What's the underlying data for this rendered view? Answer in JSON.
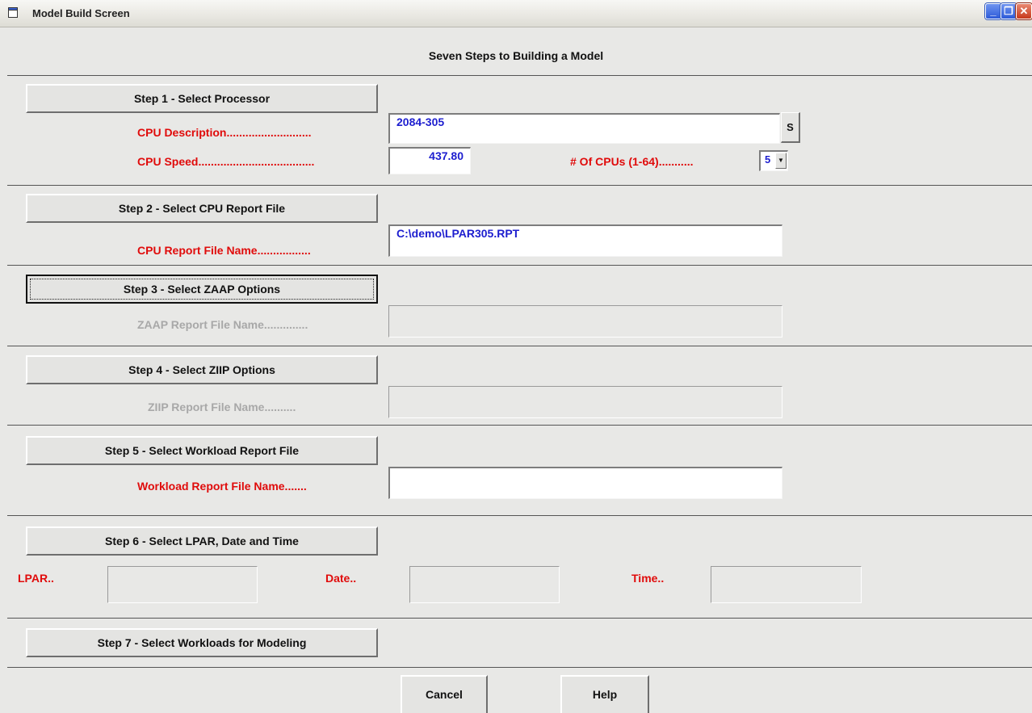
{
  "window": {
    "title": "Model Build Screen",
    "minimize": "_",
    "restore": "❐",
    "close": "✕",
    "icon": "window-app-icon"
  },
  "heading": "Seven Steps to Building a Model",
  "step1": {
    "button": "Step 1 - Select Processor",
    "cpu_description_label": "CPU Description...........................",
    "cpu_description_value": "2084-305",
    "s_button": "S",
    "cpu_speed_label": "CPU Speed.....................................",
    "cpu_speed_value": "437.80",
    "num_cpus_label": "# Of CPUs (1-64)...........",
    "num_cpus_value": "5",
    "dropdown_arrow": "▼"
  },
  "step2": {
    "button": "Step 2 - Select CPU Report File",
    "label": "CPU Report File Name.................",
    "value": "C:\\demo\\LPAR305.RPT"
  },
  "step3": {
    "button": "Step 3 - Select ZAAP Options",
    "label": "ZAAP Report File Name..............",
    "value": ""
  },
  "step4": {
    "button": "Step 4 - Select ZIIP Options",
    "label": "ZIIP Report File Name..........",
    "value": ""
  },
  "step5": {
    "button": "Step 5 - Select Workload Report File",
    "label": "Workload Report File Name.......",
    "value": ""
  },
  "step6": {
    "button": "Step 6 - Select LPAR, Date and Time",
    "lpar_label": "LPAR..",
    "lpar_value": "",
    "date_label": "Date..",
    "date_value": "",
    "time_label": "Time..",
    "time_value": ""
  },
  "step7": {
    "button": "Step 7 - Select Workloads for Modeling"
  },
  "footer": {
    "cancel": "Cancel",
    "help": "Help"
  },
  "colors": {
    "label_active": "#e00b0b",
    "label_disabled": "#a8a8a8",
    "field_text": "#1d1ecf",
    "background": "#e8e8e6"
  }
}
